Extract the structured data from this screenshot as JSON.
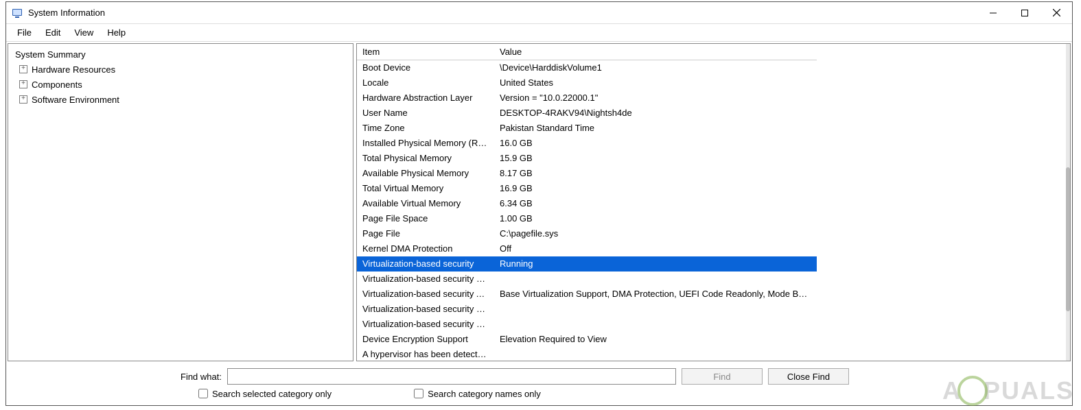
{
  "titlebar": {
    "title": "System Information"
  },
  "menubar": {
    "items": [
      "File",
      "Edit",
      "View",
      "Help"
    ]
  },
  "tree": {
    "root": "System Summary",
    "children": [
      "Hardware Resources",
      "Components",
      "Software Environment"
    ]
  },
  "detail": {
    "headers": [
      "Item",
      "Value"
    ],
    "rows": [
      {
        "item": "Boot Device",
        "value": "\\Device\\HarddiskVolume1"
      },
      {
        "item": "Locale",
        "value": "United States"
      },
      {
        "item": "Hardware Abstraction Layer",
        "value": "Version = \"10.0.22000.1\""
      },
      {
        "item": "User Name",
        "value": "DESKTOP-4RAKV94\\Nightsh4de"
      },
      {
        "item": "Time Zone",
        "value": "Pakistan Standard Time"
      },
      {
        "item": "Installed Physical Memory (RAM)",
        "value": "16.0 GB"
      },
      {
        "item": "Total Physical Memory",
        "value": "15.9 GB"
      },
      {
        "item": "Available Physical Memory",
        "value": "8.17 GB"
      },
      {
        "item": "Total Virtual Memory",
        "value": "16.9 GB"
      },
      {
        "item": "Available Virtual Memory",
        "value": "6.34 GB"
      },
      {
        "item": "Page File Space",
        "value": "1.00 GB"
      },
      {
        "item": "Page File",
        "value": "C:\\pagefile.sys"
      },
      {
        "item": "Kernel DMA Protection",
        "value": "Off"
      },
      {
        "item": "Virtualization-based security",
        "value": "Running",
        "selected": true
      },
      {
        "item": "Virtualization-based security Re...",
        "value": ""
      },
      {
        "item": "Virtualization-based security Av...",
        "value": "Base Virtualization Support, DMA Protection, UEFI Code Readonly, Mode Base..."
      },
      {
        "item": "Virtualization-based security Se...",
        "value": ""
      },
      {
        "item": "Virtualization-based security Se...",
        "value": ""
      },
      {
        "item": "Device Encryption Support",
        "value": "Elevation Required to View"
      },
      {
        "item": "A hypervisor has been detecte...",
        "value": ""
      }
    ]
  },
  "find": {
    "label": "Find what:",
    "value": "",
    "find_btn": "Find",
    "close_btn": "Close Find",
    "chk1": "Search selected category only",
    "chk2": "Search category names only"
  },
  "watermark": {
    "pre": "A",
    "post": "PUALS"
  }
}
